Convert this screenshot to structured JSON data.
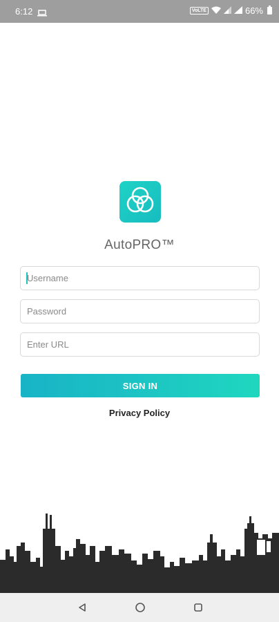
{
  "status_bar": {
    "time": "6:12",
    "network_badge": "VoLTE",
    "battery": "66%"
  },
  "app": {
    "name": "AutoPRO™"
  },
  "form": {
    "username_placeholder": "Username",
    "password_placeholder": "Password",
    "url_placeholder": "Enter URL",
    "signin_label": "SIGN IN",
    "privacy_label": "Privacy Policy"
  },
  "colors": {
    "accent": "#1fc6bf",
    "status_bar": "#9e9e9e",
    "skyline": "#2b2b2b"
  },
  "icons": {
    "logo": "three-circles-icon",
    "nav_back": "back-triangle-icon",
    "nav_home": "home-circle-icon",
    "nav_recents": "recents-square-icon"
  }
}
